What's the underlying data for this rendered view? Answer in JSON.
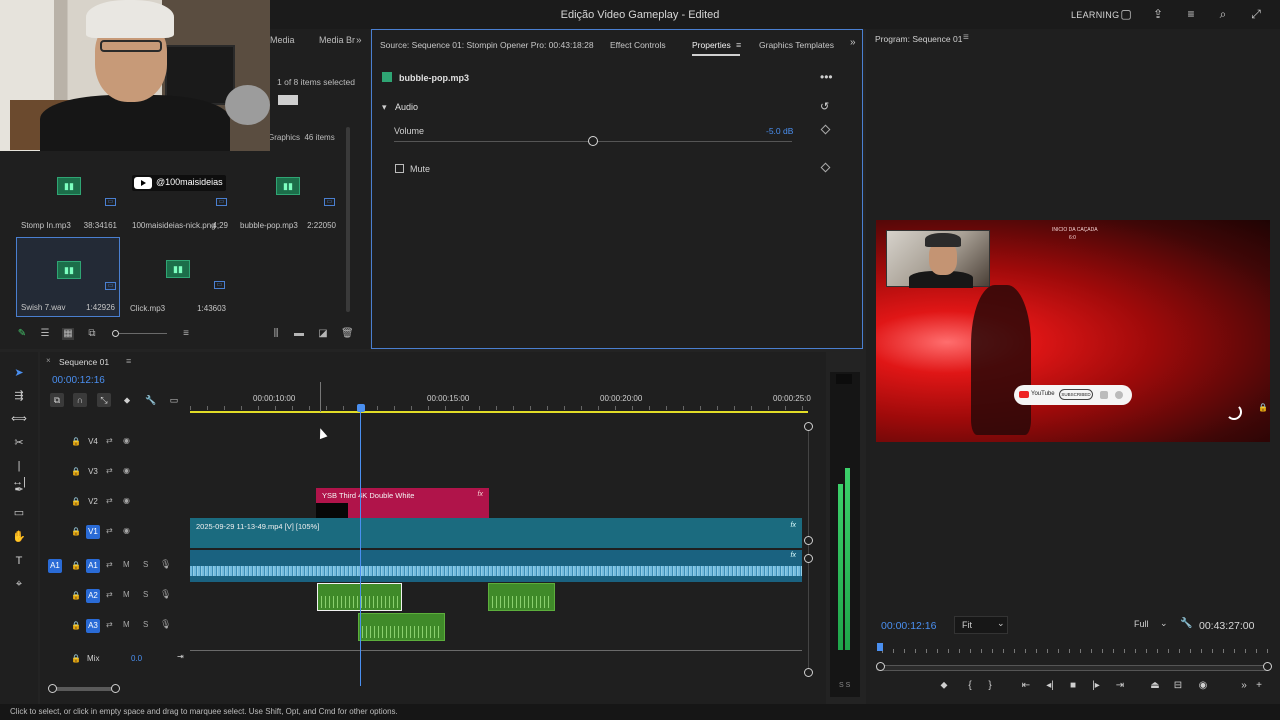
{
  "window": {
    "title": "Edição Video Gameplay - Edited",
    "learning": "LEARNING"
  },
  "project_panel": {
    "tab_media": "Media",
    "tab_media_browser": "Media Br",
    "selected_count": "1 of 8 items selected",
    "graphics_label": "Graphics",
    "graphics_count": "46 items",
    "items": [
      {
        "name": "Stomp In.mp3",
        "duration": "38:34161",
        "kind": "audio"
      },
      {
        "name": "100maisideias-nick.png",
        "duration": "4;29",
        "kind": "image",
        "overlay_text": "@100maisideias"
      },
      {
        "name": "bubble-pop.mp3",
        "duration": "2:22050",
        "kind": "audio"
      },
      {
        "name": "Swish 7.wav",
        "duration": "1:42926",
        "kind": "audio",
        "selected": true
      },
      {
        "name": "Click.mp3",
        "duration": "1:43603",
        "kind": "audio"
      }
    ]
  },
  "properties_panel": {
    "tabs": [
      "Source: Sequence 01: Stompin Opener Pro: 00:43:18:28",
      "Effect Controls",
      "Properties",
      "Graphics Templates"
    ],
    "active_tab": "Properties",
    "clip_name": "bubble-pop.mp3",
    "section": "Audio",
    "volume_label": "Volume",
    "volume_value": "-5.0 dB",
    "volume_level": 0.5,
    "mute_label": "Mute",
    "mute_checked": false
  },
  "program_monitor": {
    "title": "Program: Sequence 01",
    "timecode": "00:00:12:16",
    "fit": "Fit",
    "resolution": "Full",
    "duration": "00:43:27:00",
    "overlay_top": "INICIO DA CAÇADA",
    "overlay_top2": "6:0",
    "youtube_label": "YouTube",
    "subscribe_label": "SUBSCRIBED"
  },
  "timeline": {
    "sequence_name": "Sequence 01",
    "timecode": "00:00:12:16",
    "ruler_labels": [
      "00:00:10:00",
      "00:00:15:00",
      "00:00:20:00",
      "00:00:25:0"
    ],
    "tracks": {
      "V4": "V4",
      "V3": "V3",
      "V2": "V2",
      "V1": "V1",
      "A1": "A1",
      "A2": "A2",
      "A3": "A3"
    },
    "source_v": "V1",
    "source_a": "A1",
    "mute_letter": "M",
    "solo_letter": "S",
    "mix_label": "Mix",
    "mix_value": "0.0",
    "clips": {
      "graphic": "YSB Third 4K Double White",
      "video": "2025-09-29 11-13-49.mp4 [V] [105%]",
      "fx": "fx"
    }
  },
  "meter": {
    "footer": "S S"
  },
  "status": {
    "text": "Click to select, or click in empty space and drag to marquee select. Use Shift, Opt, and Cmd for other options."
  },
  "colors": {
    "accent": "#4a8ff0",
    "video_clip": "#1b6b7f",
    "graphic_clip": "#b0144a",
    "audio_clip": "#3f8a29"
  }
}
